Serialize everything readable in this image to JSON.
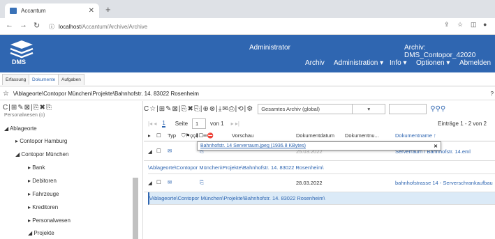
{
  "browser": {
    "tab_title": "Accantum",
    "url_host": "localhost",
    "url_path": "/Accantum/Archive/Archive"
  },
  "navbar": {
    "user": "Administrator",
    "archive_info": "Archiv: DMS_Contopor_42020",
    "menu": [
      "Archiv",
      "Administration ▾",
      "Info ▾",
      "Optionen ▾",
      "Abmelden"
    ],
    "logo_text": "DMS"
  },
  "subtabs": [
    "Erfassung",
    "Dokumente",
    "Aufgaben"
  ],
  "breadcrumb": "\\Ablageorte\\Contopor München\\Projekte\\Bahnhofstr. 14. 83022 Rosenheim",
  "tree": {
    "top_cut": "Personalwesen (o)",
    "items": [
      "Ablageorte",
      "Contopor Hamburg",
      "Contopor München",
      "Bank",
      "Debitoren",
      "Fahrzeuge",
      "Kreditoren",
      "Personalwesen",
      "Projekte"
    ]
  },
  "toolbar": {
    "scope": "Gesamtes Archiv (global)",
    "scope2": "▾"
  },
  "pager": {
    "page_label": "Seite",
    "page": "1",
    "of_label": "von 1",
    "current": "1",
    "entries": "Einträge 1 - 2 von 2"
  },
  "columns": [
    "Typ",
    "Vorschau",
    "Dokumentdatum",
    "Dokumentnu...",
    "Dokumentname ↑"
  ],
  "rows": [
    {
      "date": "25.03.2022",
      "name": "Serverraum / Bahnhofstr. 14.eml",
      "path": "\\Ablageorte\\Contopor München\\Projekte\\Bahnhofstr. 14. 83022 Rosenheim\\"
    },
    {
      "date": "28.03.2022",
      "name": "bahnhofstrasse 14 - Serverschrankaufbau",
      "path": "\\Ablageorte\\Contopor München\\Projekte\\Bahnhofstr. 14. 83022 Rosenheim\\"
    }
  ],
  "tooltip": "Bahnhofstr. 14 Serverraum.jpeg (1936.8 KBytes)"
}
